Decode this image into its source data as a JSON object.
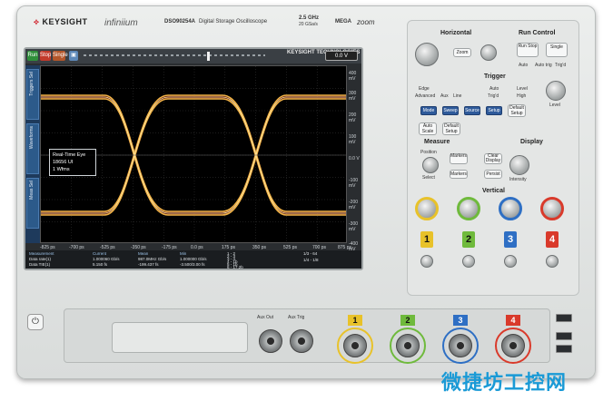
{
  "branding": {
    "maker": "KEYSIGHT",
    "series": "infiniium",
    "model": "DSO90254A",
    "description": "Digital Storage Oscilloscope",
    "bandwidth": "2.5 GHz",
    "sample_rate": "20 GSa/s",
    "logo_mega": "MEGA",
    "logo_zoom": "zoom",
    "screen_badge": "KEYSIGHT TECHNOLOGIES"
  },
  "toolbar": {
    "run": "Run",
    "stop": "Stop",
    "single": "Single",
    "trig_level": "0.0 V"
  },
  "side_tabs": [
    "Triggers Sel",
    "Waveforms",
    "Meas Sel"
  ],
  "right_scale": [
    "400 mV",
    "300 mV",
    "200 mV",
    "100 mV",
    "0.0 V",
    "-100 mV",
    "-200 mV",
    "-300 mV",
    "-400 mV"
  ],
  "bottom_scale": [
    "-825 ps",
    "-700 ps",
    "-525 ps",
    "-350 ps",
    "-175 ps",
    "0.0 ps",
    "175 ps",
    "350 ps",
    "525 ps",
    "700 ps",
    "875 ps"
  ],
  "eye_box": {
    "line1": "Real-Time Eye",
    "line2": "18656 UI",
    "line3": "1 Wfms"
  },
  "measurements": {
    "header": [
      "Measurement",
      "Current",
      "Mean",
      "Min"
    ],
    "rows": [
      [
        "Data rate(1)",
        "1.000060 Gb/s",
        "987.0MHz Gb/s",
        "1.000000 Gb/s"
      ],
      [
        "Data TIE(1)",
        "5.150 fs",
        "-199.437 fs",
        "-3.500/3.00 fs"
      ]
    ],
    "legend": [
      "1 - 2",
      "2 - 3",
      "3 - 4",
      "4 - 1b",
      "5 - 1b",
      "6 - 17.2b"
    ],
    "legend2": [
      "1/3 - 64",
      "1/4 - 1/8"
    ]
  },
  "controls": {
    "horizontal": "Horizontal",
    "run_control": "Run Control",
    "run_stop": "Run Stop",
    "single": "Single",
    "auto": "Auto",
    "auto_trig": "Auto trig",
    "trig_d": "Trig'd",
    "zoom": "Zoom",
    "trigger": "Trigger",
    "edge": "Edge",
    "advanced": "Advanced",
    "aux": "Aux",
    "line": "Line",
    "auto_mode": "Auto",
    "trig_d2": "Trig'd",
    "level": "Level",
    "high": "High",
    "level_knob": "Level",
    "measure": "Measure",
    "display": "Display",
    "position": "Position",
    "select": "Select",
    "intensity": "Intensity",
    "markers": "Markers",
    "vertical": "Vertical",
    "mode": "Mode",
    "sweep": "Sweep",
    "source": "Source",
    "setup": "Setup",
    "clear_display": "Clear Display",
    "persist": "Persist",
    "auto_scale": "Auto Scale",
    "default_setup": "Default Setup",
    "channels": [
      "1",
      "2",
      "3",
      "4"
    ]
  },
  "front": {
    "aux_out": "Aux Out",
    "aux_trig": "Aux Trig",
    "channels": [
      "1",
      "2",
      "3",
      "4"
    ]
  },
  "colors": {
    "ch1": "#e8c22a",
    "ch2": "#6fba3c",
    "ch3": "#2e6fc4",
    "ch4": "#d93a2b",
    "eye_trace": "#e8a23c"
  },
  "watermark": "微捷坊工控网"
}
